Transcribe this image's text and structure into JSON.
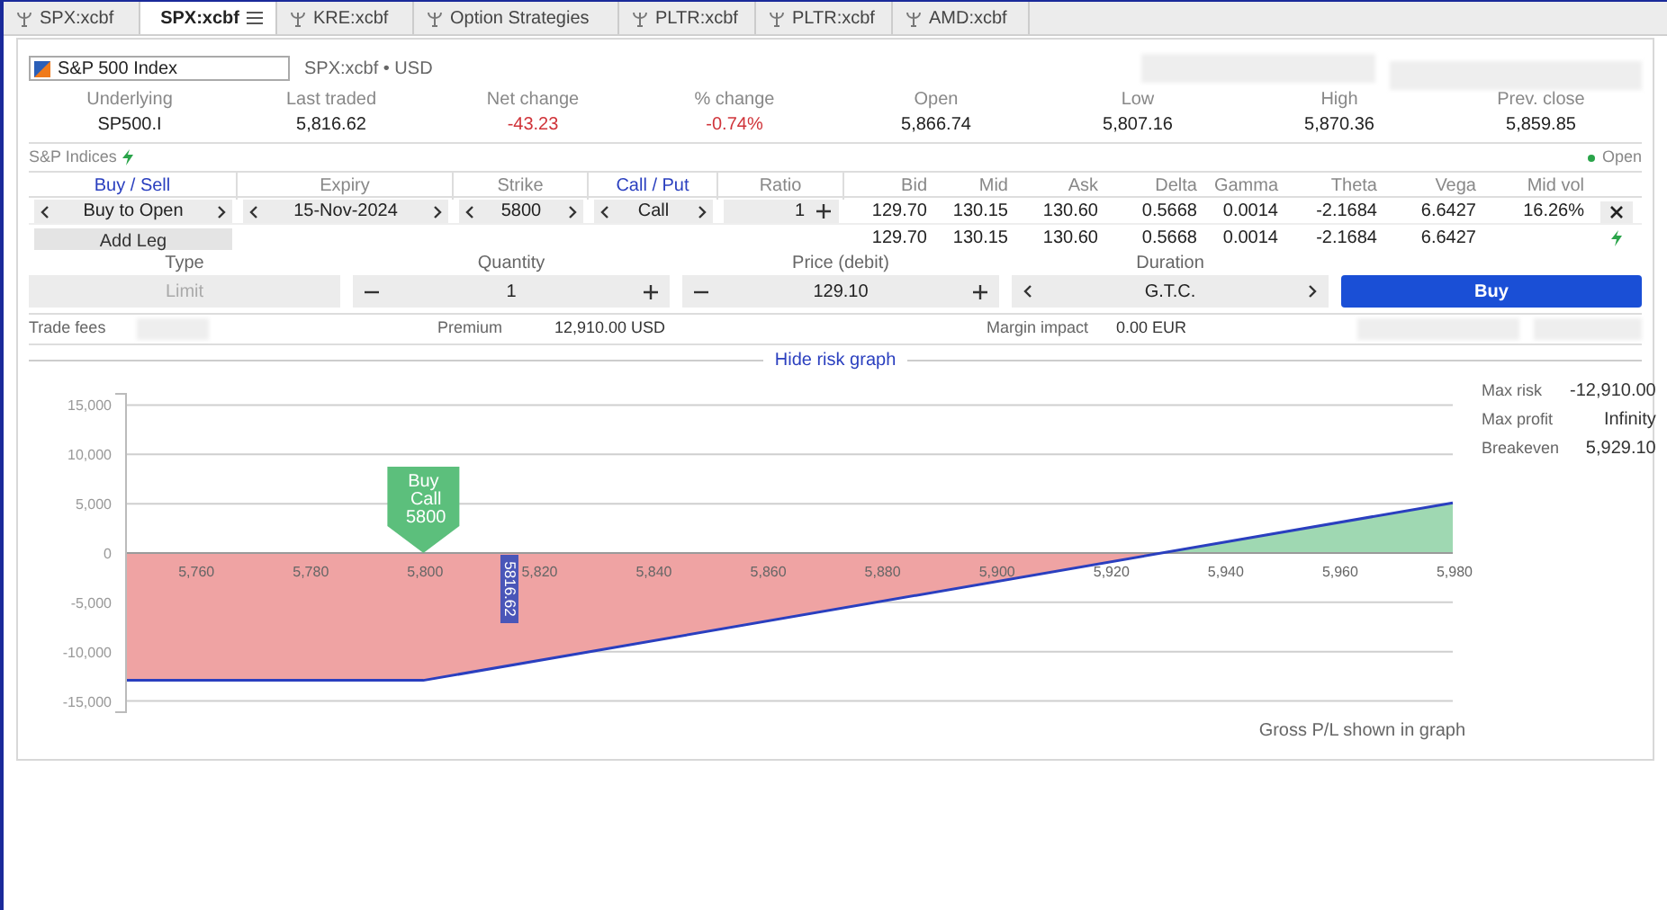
{
  "tabs": [
    {
      "label": "SPX:xcbf",
      "selected": false
    },
    {
      "label": "SPX:xcbf",
      "selected": true,
      "menu": true
    },
    {
      "label": "KRE:xcbf",
      "selected": false
    },
    {
      "label": "Option Strategies",
      "selected": false
    },
    {
      "label": "PLTR:xcbf",
      "selected": false
    },
    {
      "label": "PLTR:xcbf",
      "selected": false
    },
    {
      "label": "AMD:xcbf",
      "selected": false
    }
  ],
  "instrument": {
    "value": "S&P 500 Index",
    "symbol": "SPX:xcbf • USD"
  },
  "quote": [
    {
      "label": "Underlying",
      "value": "SP500.I"
    },
    {
      "label": "Last traded",
      "value": "5,816.62"
    },
    {
      "label": "Net change",
      "value": "-43.23",
      "color": "#d0343a"
    },
    {
      "label": "% change",
      "value": "-0.74%",
      "color": "#d0343a"
    },
    {
      "label": "Open",
      "value": "5,866.74"
    },
    {
      "label": "Low",
      "value": "5,807.16"
    },
    {
      "label": "High",
      "value": "5,870.36"
    },
    {
      "label": "Prev. close",
      "value": "5,859.85"
    }
  ],
  "exchange": {
    "label": "S&P Indices",
    "market_status": "Open"
  },
  "legs_table": {
    "columns": [
      {
        "label": "Buy / Sell",
        "link": true
      },
      {
        "label": "Expiry",
        "link": false
      },
      {
        "label": "Strike",
        "link": false
      },
      {
        "label": "Call / Put",
        "link": true
      },
      {
        "label": "Ratio",
        "link": false
      },
      {
        "label": "Bid",
        "link": false
      },
      {
        "label": "Mid",
        "link": false
      },
      {
        "label": "Ask",
        "link": false
      },
      {
        "label": "Delta",
        "link": false
      },
      {
        "label": "Gamma",
        "link": false
      },
      {
        "label": "Theta",
        "link": false
      },
      {
        "label": "Vega",
        "link": false
      },
      {
        "label": "Mid vol",
        "link": false
      }
    ],
    "legs": [
      {
        "side": "Buy to Open",
        "expiry": "15-Nov-2024",
        "strike": "5800",
        "type": "Call",
        "ratio": "1",
        "bid": "129.70",
        "mid": "130.15",
        "ask": "130.60",
        "delta": "0.5668",
        "gamma": "0.0014",
        "theta": "-2.1684",
        "vega": "6.6427",
        "mid_vol": "16.26%"
      }
    ],
    "add_leg": "Add Leg",
    "totals": {
      "bid": "129.70",
      "mid": "130.15",
      "ask": "130.60",
      "delta": "0.5668",
      "gamma": "0.0014",
      "theta": "-2.1684",
      "vega": "6.6427"
    }
  },
  "order": {
    "type": {
      "label": "Type",
      "value": "Limit",
      "disabled": true
    },
    "quantity": {
      "label": "Quantity",
      "value": "1"
    },
    "price": {
      "label": "Price (debit)",
      "value": "129.10"
    },
    "duration": {
      "label": "Duration",
      "value": "G.T.C."
    },
    "submit": "Buy"
  },
  "summary": {
    "trade_fees": "Trade fees",
    "premium_label": "Premium",
    "premium": "12,910.00 USD",
    "margin_label": "Margin impact",
    "margin": "0.00 EUR"
  },
  "risk_graph": {
    "toggle": "Hide risk graph",
    "stats": [
      {
        "label": "Max risk",
        "value": "-12,910.00"
      },
      {
        "label": "Max profit",
        "value": "Infinity"
      },
      {
        "label": "Breakeven",
        "value": "5,929.10"
      }
    ],
    "footnote": "Gross P/L shown in graph",
    "chart_data": {
      "type": "line",
      "x": [
        5748,
        5800,
        5980
      ],
      "grid": true,
      "series": [
        {
          "color": "#2a3fbf",
          "values": [
            -12910,
            -12910,
            5090
          ]
        }
      ],
      "xlim": [
        5748,
        5980
      ],
      "ylim": [
        -16500,
        16500
      ],
      "xticks": [
        {
          "value": 5760,
          "label": "5,760"
        },
        {
          "value": 5780,
          "label": "5,780"
        },
        {
          "value": 5800,
          "label": "5,800"
        },
        {
          "value": 5820,
          "label": "5,820"
        },
        {
          "value": 5840,
          "label": "5,840"
        },
        {
          "value": 5860,
          "label": "5,860"
        },
        {
          "value": 5880,
          "label": "5,880"
        },
        {
          "value": 5900,
          "label": "5,900"
        },
        {
          "value": 5920,
          "label": "5,920"
        },
        {
          "value": 5940,
          "label": "5,940"
        },
        {
          "value": 5960,
          "label": "5,960"
        },
        {
          "value": 5980,
          "label": "5,980"
        }
      ],
      "yticks": [
        {
          "value": 15000,
          "label": "15,000"
        },
        {
          "value": 10000,
          "label": "10,000"
        },
        {
          "value": 5000,
          "label": "5,000"
        },
        {
          "value": 0,
          "label": "0"
        },
        {
          "value": -5000,
          "label": "-5,000"
        },
        {
          "value": -10000,
          "label": "-10,000"
        },
        {
          "value": -15000,
          "label": "-15,000"
        }
      ],
      "annotations": [
        "Buy Call 5800",
        "5816.62"
      ]
    }
  }
}
